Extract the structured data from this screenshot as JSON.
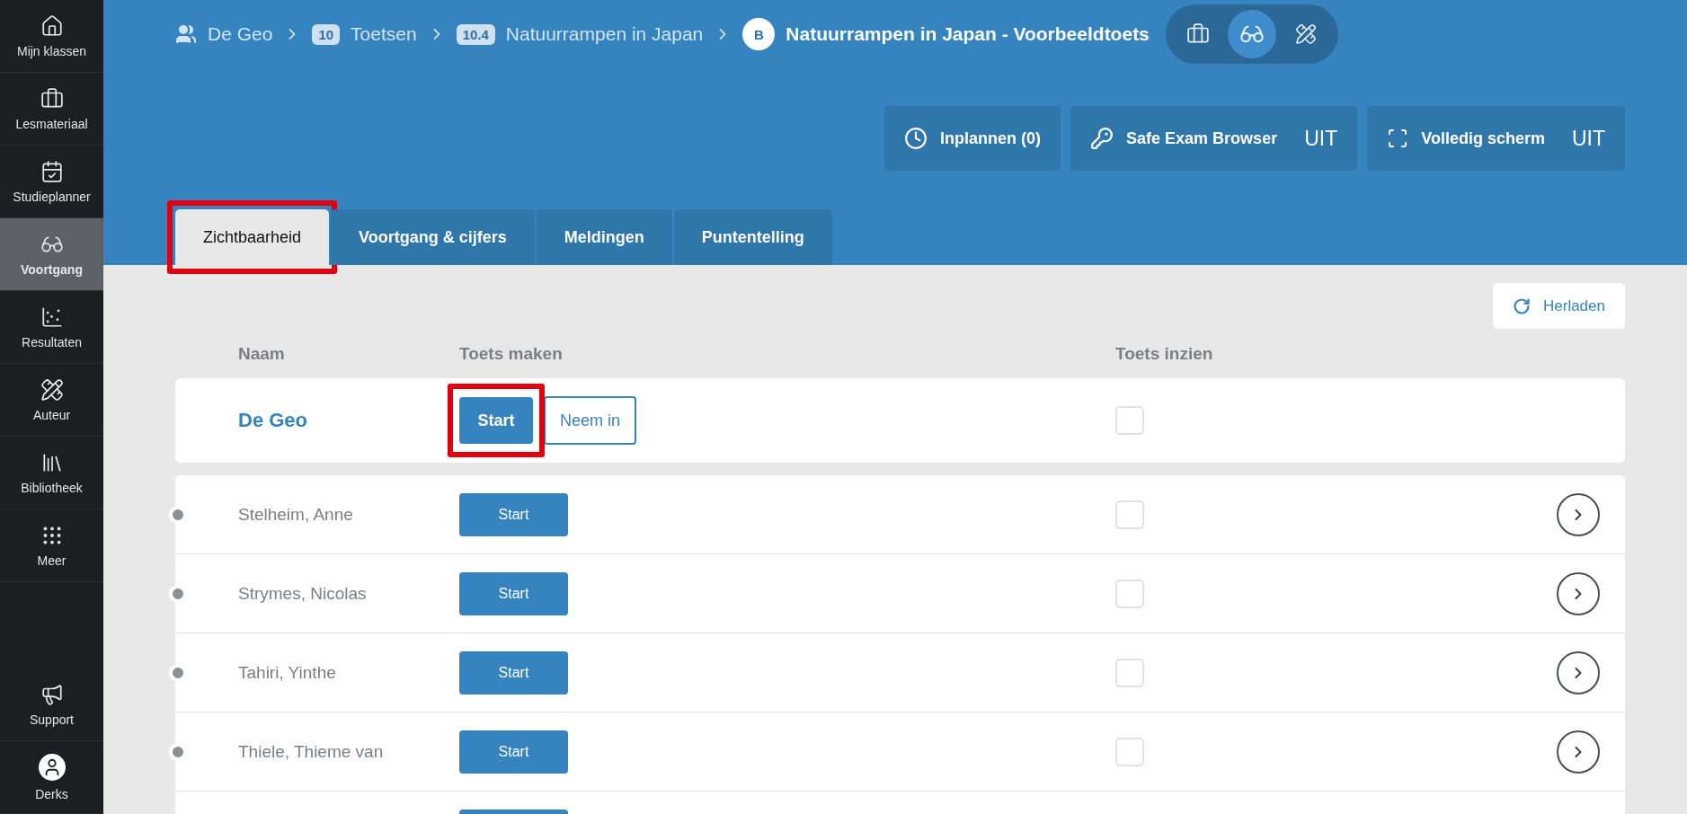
{
  "sidebar": {
    "items": [
      {
        "kind": "home",
        "label": "Mijn klassen",
        "selected": false
      },
      {
        "kind": "briefcase",
        "label": "Lesmateriaal",
        "selected": false
      },
      {
        "kind": "calendar",
        "label": "Studieplanner",
        "selected": false
      },
      {
        "kind": "glasses",
        "label": "Voortgang",
        "selected": true
      },
      {
        "kind": "scatter",
        "label": "Resultaten",
        "selected": false
      },
      {
        "kind": "pencil-ruler",
        "label": "Auteur",
        "selected": false
      },
      {
        "kind": "library",
        "label": "Bibliotheek",
        "selected": false
      },
      {
        "kind": "grid",
        "label": "Meer",
        "selected": false
      }
    ],
    "bottom": [
      {
        "kind": "megaphone",
        "label": "Support",
        "selected": false
      },
      {
        "kind": "avatar",
        "label": "Derks",
        "selected": false
      }
    ]
  },
  "breadcrumb": [
    {
      "kind": "group",
      "label": "De Geo"
    },
    {
      "kind": "badge",
      "badge": "10",
      "label": "Toetsen"
    },
    {
      "kind": "badge",
      "badge": "10.4",
      "label": "Natuurrampen in Japan"
    },
    {
      "kind": "current",
      "badge": "B",
      "label": "Natuurrampen in Japan - Voorbeeldtoets"
    }
  ],
  "view_switch": [
    {
      "kind": "briefcase",
      "selected": false
    },
    {
      "kind": "glasses",
      "selected": true
    },
    {
      "kind": "pencil-ruler",
      "selected": false
    }
  ],
  "actions": [
    {
      "kind": "schedule",
      "label": "Inplannen (0)"
    },
    {
      "kind": "key",
      "label": "Safe Exam Browser",
      "value": "UIT"
    },
    {
      "kind": "fullscreen",
      "label": "Volledig scherm",
      "value": "UIT"
    }
  ],
  "tabs": [
    {
      "label": "Zichtbaarheid",
      "selected": true,
      "highlighted": true
    },
    {
      "label": "Voortgang & cijfers",
      "selected": false,
      "highlighted": false
    },
    {
      "label": "Meldingen",
      "selected": false,
      "highlighted": false
    },
    {
      "label": "Puntentelling",
      "selected": false,
      "highlighted": false
    }
  ],
  "reload_button": "Herladen",
  "table": {
    "columns": [
      "Naam",
      "Toets maken",
      "Toets inzien"
    ],
    "class_row": {
      "name": "De Geo",
      "start": "Start",
      "start_highlighted": true,
      "take_in": "Neem in",
      "review_checked": false
    },
    "students": [
      {
        "name": "Stelheim, Anne",
        "start": "Start",
        "review_checked": false
      },
      {
        "name": "Strymes, Nicolas",
        "start": "Start",
        "review_checked": false
      },
      {
        "name": "Tahiri, Yinthe",
        "start": "Start",
        "review_checked": false
      },
      {
        "name": "Thiele, Thieme van",
        "start": "Start",
        "review_checked": false
      }
    ],
    "more_rows_below": true
  }
}
